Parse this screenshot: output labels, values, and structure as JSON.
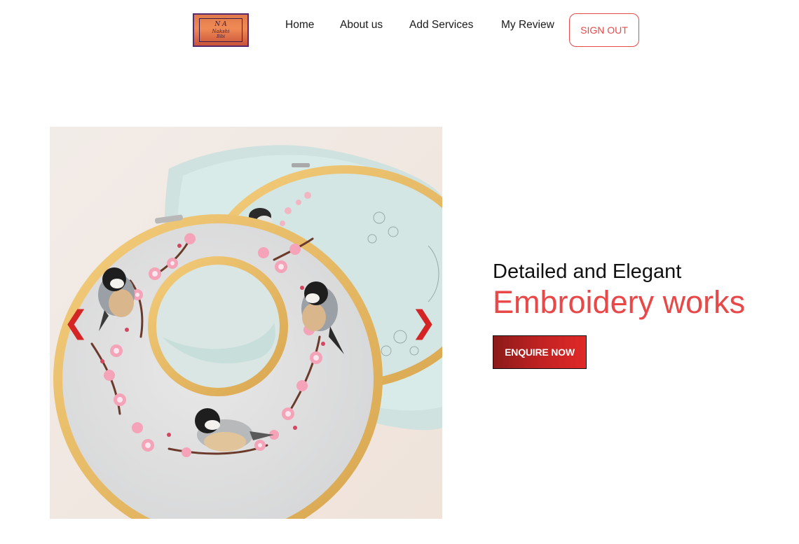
{
  "logo": {
    "monogram": "N A",
    "name": "Nakshi",
    "sub": "Bibi"
  },
  "nav": {
    "home": "Home",
    "about": "About us",
    "add_services": "Add Services",
    "my_review": "My Review",
    "sign_out": "SIGN OUT"
  },
  "carousel": {
    "prev_arrow": "❮",
    "next_arrow": "❯"
  },
  "hero": {
    "line1": "Detailed and Elegant",
    "line2": "Embroidery works",
    "cta": "ENQUIRE NOW"
  },
  "colors": {
    "accent": "#e84848",
    "cta_dark": "#8c1a1a",
    "cta_light": "#e02828",
    "arrow": "#d42424"
  },
  "icons": {
    "prev": "chevron-left-icon",
    "next": "chevron-right-icon"
  }
}
